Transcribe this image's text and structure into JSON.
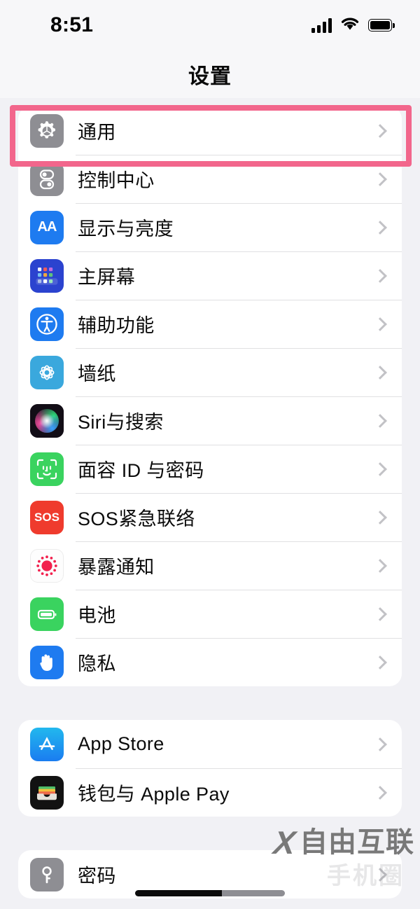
{
  "status_bar": {
    "time": "8:51",
    "signal_icon": "cellular-bars-icon",
    "wifi_icon": "wifi-icon",
    "battery_icon": "battery-full-icon"
  },
  "nav": {
    "title": "设置"
  },
  "highlight": {
    "color": "#f2668c",
    "target_row": "通用"
  },
  "groups": [
    {
      "id": "system-group",
      "rows": [
        {
          "label": "通用",
          "icon": "gear-icon",
          "chevron": "chevron-right-icon"
        },
        {
          "label": "控制中心",
          "icon": "control-center-icon",
          "chevron": "chevron-right-icon"
        },
        {
          "label": "显示与亮度",
          "icon": "display-aa-icon",
          "chevron": "chevron-right-icon"
        },
        {
          "label": "主屏幕",
          "icon": "home-screen-icon",
          "chevron": "chevron-right-icon"
        },
        {
          "label": "辅助功能",
          "icon": "accessibility-icon",
          "chevron": "chevron-right-icon"
        },
        {
          "label": "墙纸",
          "icon": "wallpaper-icon",
          "chevron": "chevron-right-icon"
        },
        {
          "label": "Siri与搜索",
          "icon": "siri-icon",
          "chevron": "chevron-right-icon"
        },
        {
          "label": "面容 ID 与密码",
          "icon": "face-id-icon",
          "chevron": "chevron-right-icon"
        },
        {
          "label": "SOS紧急联络",
          "icon": "sos-icon",
          "chevron": "chevron-right-icon"
        },
        {
          "label": "暴露通知",
          "icon": "exposure-notification-icon",
          "chevron": "chevron-right-icon"
        },
        {
          "label": "电池",
          "icon": "battery-icon",
          "chevron": "chevron-right-icon"
        },
        {
          "label": "隐私",
          "icon": "privacy-hand-icon",
          "chevron": "chevron-right-icon"
        }
      ]
    },
    {
      "id": "store-group",
      "rows": [
        {
          "label": "App Store",
          "icon": "app-store-icon",
          "chevron": "chevron-right-icon"
        },
        {
          "label": "钱包与 Apple Pay",
          "icon": "wallet-icon",
          "chevron": "chevron-right-icon"
        }
      ]
    },
    {
      "id": "passwords-group",
      "rows": [
        {
          "label": "密码",
          "icon": "key-icon",
          "chevron": "chevron-right-icon"
        }
      ]
    }
  ],
  "watermark": {
    "mark": "X",
    "text": "自由互联",
    "sub_text": "手机圈"
  },
  "colors": {
    "page_background": "#f1f1f5",
    "card_background": "#ffffff",
    "highlight_pink": "#f2668c",
    "separator": "#e0e0e2",
    "chevron_gray": "#c2c2c6",
    "label_text": "#0b0b0b"
  }
}
